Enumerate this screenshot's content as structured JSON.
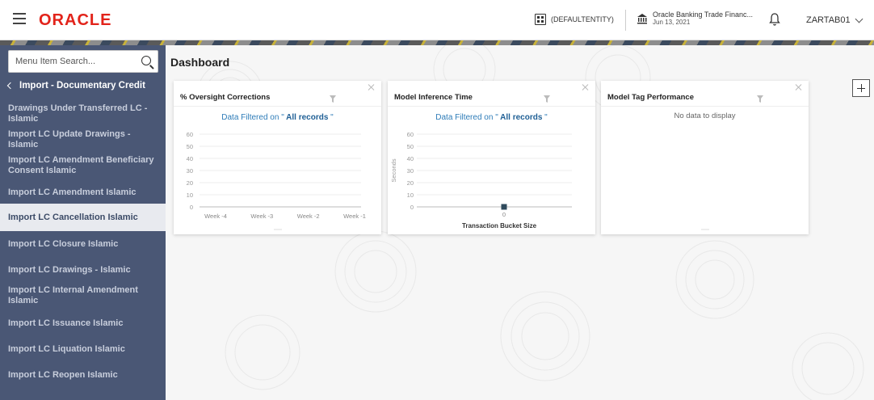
{
  "header": {
    "logo": "ORACLE",
    "entity": "(DEFAULTENTITY)",
    "bank_name": "Oracle Banking Trade Financ...",
    "bank_date": "Jun 13, 2021",
    "user": "ZARTAB01"
  },
  "sidebar": {
    "search_placeholder": "Menu Item Search...",
    "back_label": "Import - Documentary Credit",
    "items": [
      {
        "label": "Drawings Under Transferred LC - Islamic"
      },
      {
        "label": "Import LC Update Drawings - Islamic"
      },
      {
        "label": "Import LC Amendment Beneficiary Consent Islamic"
      },
      {
        "label": "Import LC Amendment Islamic"
      },
      {
        "label": "Import LC Cancellation Islamic"
      },
      {
        "label": "Import LC Closure Islamic"
      },
      {
        "label": "Import LC Drawings - Islamic"
      },
      {
        "label": "Import LC Internal Amendment Islamic"
      },
      {
        "label": "Import LC Issuance Islamic"
      },
      {
        "label": "Import LC Liquation Islamic"
      },
      {
        "label": "Import LC Reopen Islamic"
      }
    ],
    "active_index": 4
  },
  "main": {
    "title": "Dashboard",
    "cards": [
      {
        "title": "% Oversight Corrections",
        "filter_prefix": "Data Filtered on \"",
        "filter_value": " All records",
        "filter_suffix": " \""
      },
      {
        "title": "Model Inference Time",
        "filter_prefix": "Data Filtered on \"",
        "filter_value": " All records",
        "filter_suffix": " \""
      },
      {
        "title": "Model Tag Performance",
        "no_data": "No data to display"
      }
    ]
  },
  "chart_data": [
    {
      "type": "line",
      "title": "% Oversight Corrections",
      "categories": [
        "Week -4",
        "Week -3",
        "Week -2",
        "Week -1"
      ],
      "yticks": [
        0,
        10,
        20,
        30,
        40,
        50,
        60
      ],
      "ylim": [
        0,
        60
      ],
      "series": [],
      "grid": true
    },
    {
      "type": "scatter",
      "title": "Model Inference Time",
      "xlabel": "Transaction Bucket Size",
      "ylabel": "Seconds",
      "categories": [
        "0"
      ],
      "yticks": [
        0,
        10,
        20,
        30,
        40,
        50,
        60
      ],
      "ylim": [
        0,
        60
      ],
      "series": [
        {
          "values": [
            0
          ]
        }
      ],
      "grid": true,
      "colors": {
        "point": "#2f4a5c"
      }
    }
  ]
}
